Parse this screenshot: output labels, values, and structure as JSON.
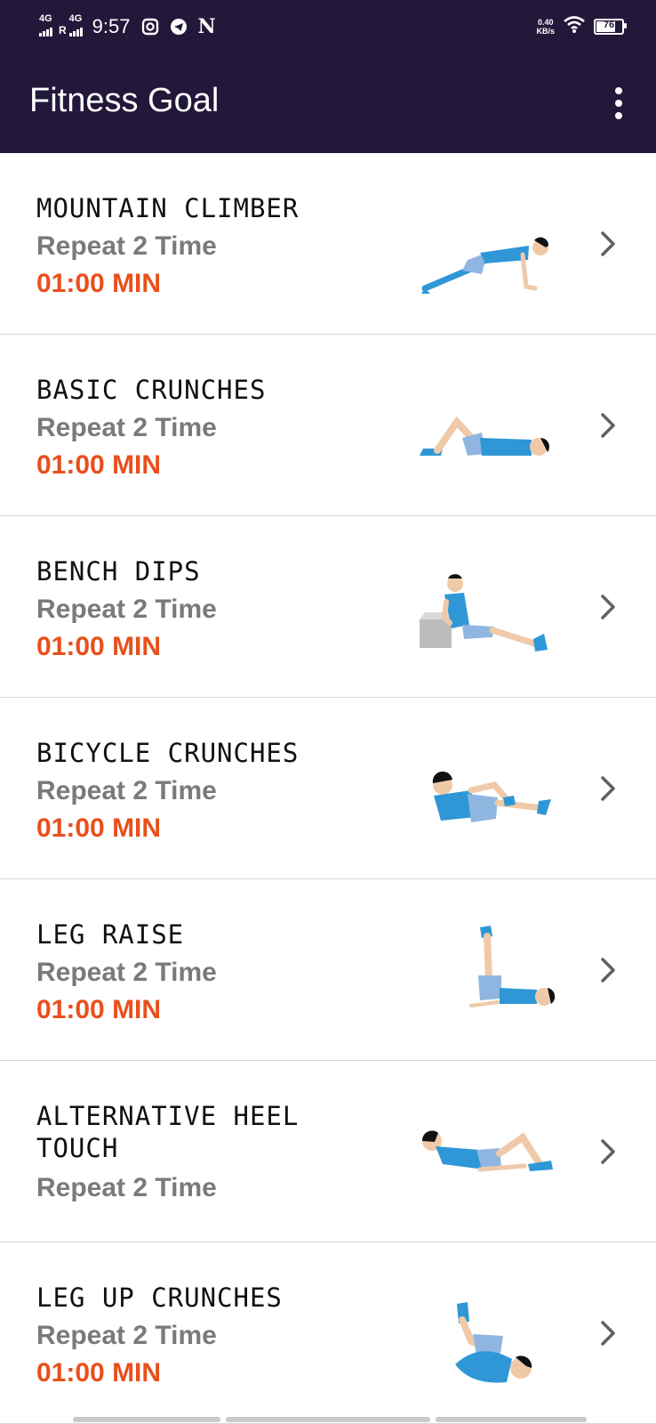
{
  "status_bar": {
    "network1": "4G",
    "network2": "4G",
    "roaming": "R",
    "time": "9:57",
    "notif_letter": "N",
    "speed_value": "0.40",
    "speed_unit": "KB/s",
    "battery": "76"
  },
  "app_bar": {
    "title": "Fitness Goal",
    "overflow_icon": "more-vert-icon"
  },
  "colors": {
    "app_bar_bg": "#221839",
    "duration": "#e8501c",
    "repeat": "#7a7a7a",
    "figure_shirt": "#2f97d6",
    "figure_shorts": "#8fb6e0"
  },
  "exercises": [
    {
      "name": "MOUNTAIN CLIMBER",
      "repeat": "Repeat 2 Time",
      "duration": "01:00 MIN",
      "icon": "mountain-climber-figure"
    },
    {
      "name": "BASIC CRUNCHES",
      "repeat": "Repeat 2 Time",
      "duration": "01:00 MIN",
      "icon": "basic-crunches-figure"
    },
    {
      "name": "BENCH DIPS",
      "repeat": "Repeat 2 Time",
      "duration": "01:00 MIN",
      "icon": "bench-dips-figure"
    },
    {
      "name": "BICYCLE CRUNCHES",
      "repeat": "Repeat 2 Time",
      "duration": "01:00 MIN",
      "icon": "bicycle-crunches-figure"
    },
    {
      "name": "LEG RAISE",
      "repeat": "Repeat 2 Time",
      "duration": "01:00 MIN",
      "icon": "leg-raise-figure"
    },
    {
      "name": "ALTERNATIVE HEEL TOUCH",
      "repeat": "Repeat 2 Time",
      "duration": "",
      "icon": "heel-touch-figure"
    },
    {
      "name": "LEG UP CRUNCHES",
      "repeat": "Repeat 2 Time",
      "duration": "01:00 MIN",
      "icon": "leg-up-crunches-figure"
    }
  ]
}
